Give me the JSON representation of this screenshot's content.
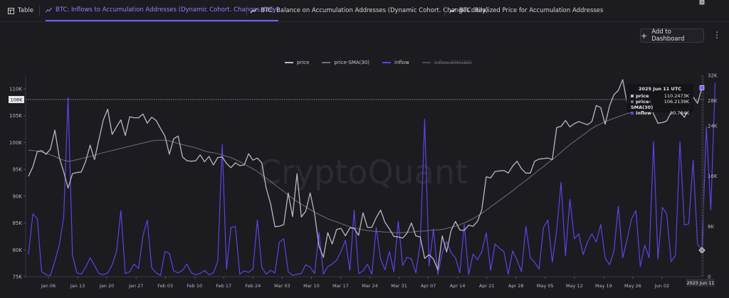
{
  "tabs": [
    {
      "label": "Table",
      "icon": "table-icon"
    },
    {
      "label": "BTC: Inflows to Accumulation Addresses (Dynamic Cohort. Changes daily)",
      "icon": "chart-icon",
      "active": true
    },
    {
      "label": "BTC: Balance on Accumulation Addresses (Dynamic Cohort. Changes daily)",
      "icon": "chart-icon"
    },
    {
      "label": "BTC: Realized Price for Accumulation Addresses",
      "icon": "chart-icon"
    }
  ],
  "toolbar": {
    "add_dashboard": "Add to Dashboard",
    "more": "⋮"
  },
  "watermark": "CryptoQuant",
  "colors": {
    "price": "#b8b8c0",
    "sma": "#6e6e76",
    "inflow": "#5b45e6",
    "inflow_sma": "#6a6a72"
  },
  "tooltip": {
    "date": "2025 Jun 11 UTC",
    "rows": [
      {
        "key": "price",
        "value": "110.2473K"
      },
      {
        "key": "price-SMA(30)",
        "value": "106.2139K"
      },
      {
        "key": "inflow",
        "value": "30.784K"
      }
    ]
  },
  "chart_data": {
    "type": "line",
    "legend": [
      {
        "name": "price",
        "color": "#b8b8c0",
        "hidden": false
      },
      {
        "name": "price-SMA(30)",
        "color": "#6e6e76",
        "hidden": false
      },
      {
        "name": "inflow",
        "color": "#5b45e6",
        "hidden": false
      },
      {
        "name": "inflow-SMA(30)",
        "color": "#6a6a72",
        "hidden": true
      }
    ],
    "left_axis": {
      "min": 75000,
      "max": 112500,
      "ticks": [
        75000,
        80000,
        85000,
        90000,
        95000,
        100000,
        105000,
        110000
      ],
      "tick_labels": [
        "75K",
        "80K",
        "85K",
        "90K",
        "95K",
        "100K",
        "105K",
        "110K"
      ]
    },
    "right_axis": {
      "min": 0,
      "max": 32000,
      "ticks": [
        0,
        8000,
        16000,
        24000,
        28000,
        32000
      ],
      "tick_labels": [
        "0",
        "8K",
        "16K",
        "24K",
        "28K",
        "32K"
      ]
    },
    "x_labels": [
      "Jan 06",
      "Jan 13",
      "Jan 20",
      "Jan 27",
      "Feb 03",
      "Feb 10",
      "Feb 17",
      "Feb 24",
      "Mar 03",
      "Mar 10",
      "Mar 17",
      "Mar 24",
      "Mar 31",
      "Apr 07",
      "Apr 14",
      "Apr 21",
      "Apr 28",
      "May 05",
      "May 12",
      "May 19",
      "May 26",
      "Jun 02"
    ],
    "hover_x_label": "2025 Jun 11",
    "ref_line": {
      "value": 108000,
      "label": "108K"
    },
    "series": [
      {
        "name": "price",
        "values": [
          93.7,
          95.5,
          98.3,
          98.5,
          97.8,
          98.8,
          102.3,
          97.2,
          94.5,
          91.5,
          94.2,
          94.4,
          94.5,
          96.5,
          99.5,
          96.8,
          100.5,
          104.2,
          106.2,
          101.5,
          102.9,
          104.2,
          101.3,
          104.8,
          104.6,
          104.6,
          105.3,
          103.6,
          104.7,
          104.1,
          102.6,
          101.2,
          97.8,
          100.7,
          101.2,
          97.3,
          96.6,
          96.5,
          96.6,
          97.7,
          96.4,
          97.4,
          95.8,
          97.2,
          97.3,
          96.1,
          95.3,
          96.2,
          95.7,
          95.8,
          97.9,
          96.7,
          97.1,
          96.2,
          91.5,
          88.6,
          84.3,
          84.4,
          84.7,
          90.6,
          86.2,
          94.2,
          86.1,
          87.2,
          90.6,
          86.7,
          80.7,
          78.6,
          83.2,
          81.1,
          83.8,
          84.0,
          82.6,
          84.1,
          84.0,
          82.7,
          86.9,
          84.2,
          84.2,
          86.0,
          87.4,
          85.1,
          83.9,
          82.5,
          82.4,
          82.2,
          83.1,
          85.0,
          82.6,
          82.4,
          78.4,
          79.1,
          78.3,
          76.3,
          82.6,
          79.6,
          83.6,
          85.3,
          83.7,
          83.6,
          84.6,
          84.4,
          85.3,
          87.5,
          93.6,
          93.4,
          94.6,
          94.7,
          94.8,
          94.3,
          95.6,
          96.5,
          95.1,
          94.3,
          94.3,
          96.5,
          96.9,
          97.0,
          97.1,
          96.8,
          102.8,
          103.0,
          104.1,
          102.9,
          103.5,
          103.9,
          103.6,
          103.3,
          103.9,
          106.9,
          106.5,
          103.4,
          106.8,
          108.9,
          109.7,
          111.7,
          107.3,
          109.0,
          108.9,
          107.8,
          109.0,
          108.8,
          105.3,
          103.6,
          103.7,
          104.0,
          105.6,
          105.8,
          105.7,
          104.7,
          106.3,
          108.5,
          107.3,
          110.2
        ]
      },
      {
        "name": "price-SMA(30)",
        "values": [
          98.6,
          98.5,
          98.4,
          98.2,
          98.0,
          97.7,
          97.4,
          97.0,
          96.7,
          96.5,
          96.6,
          96.8,
          97.0,
          97.2,
          97.4,
          97.6,
          97.9,
          98.1,
          98.3,
          98.5,
          98.7,
          98.9,
          99.1,
          99.3,
          99.5,
          99.7,
          99.9,
          100.1,
          100.3,
          100.4,
          100.4,
          100.4,
          100.3,
          100.1,
          99.8,
          99.6,
          99.4,
          99.2,
          99.0,
          98.7,
          98.4,
          98.2,
          98.1,
          97.9,
          97.7,
          97.4,
          97.2,
          96.8,
          96.4,
          96.0,
          95.5,
          95.1,
          94.6,
          94.0,
          93.4,
          92.8,
          92.1,
          91.5,
          90.9,
          90.2,
          89.6,
          89.0,
          88.5,
          88.0,
          87.5,
          87.0,
          86.6,
          86.2,
          85.8,
          85.5,
          85.2,
          84.9,
          84.6,
          84.3,
          84.1,
          83.9,
          83.7,
          83.6,
          83.5,
          83.4,
          83.4,
          83.3,
          83.3,
          83.2,
          83.2,
          83.2,
          83.3,
          83.3,
          83.4,
          83.5,
          83.5,
          83.6,
          83.7,
          83.7,
          83.8,
          84.0,
          84.2,
          84.4,
          84.7,
          85.0,
          85.4,
          85.8,
          86.3,
          86.8,
          87.4,
          88.0,
          88.6,
          89.2,
          89.8,
          90.4,
          91.0,
          91.7,
          92.3,
          92.9,
          93.6,
          94.2,
          94.9,
          95.5,
          96.2,
          96.8,
          97.5,
          98.2,
          98.9,
          99.6,
          100.2,
          100.8,
          101.4,
          102.0,
          102.6,
          103.1,
          103.5,
          103.9,
          104.2,
          104.5,
          104.8,
          105.1,
          105.4,
          105.6,
          105.8,
          105.9,
          106.0,
          106.05,
          106.1,
          106.12,
          106.15,
          106.17,
          106.19,
          106.2,
          106.21,
          106.21,
          106.21,
          106.2139
        ]
      },
      {
        "name": "inflow",
        "values": [
          3.5,
          10.0,
          9.2,
          0.8,
          0.3,
          0.2,
          2.5,
          5.0,
          9.5,
          28.5,
          3.4,
          0.6,
          0.4,
          1.5,
          3.0,
          1.8,
          0.5,
          0.3,
          0.6,
          1.9,
          4.0,
          10.5,
          0.5,
          0.8,
          2.0,
          1.3,
          6.5,
          9.0,
          1.4,
          0.6,
          0.2,
          4.0,
          3.7,
          0.9,
          0.6,
          1.0,
          2.0,
          0.6,
          0.3,
          0.5,
          1.0,
          0.3,
          0.6,
          2.4,
          21.0,
          1.2,
          7.8,
          8.0,
          0.4,
          0.9,
          0.7,
          1.2,
          9.0,
          1.5,
          0.4,
          1.0,
          0.6,
          5.5,
          6.0,
          0.8,
          0.2,
          0.4,
          0.5,
          1.9,
          1.5,
          0.5,
          7.0,
          0.4,
          1.6,
          2.0,
          2.6,
          4.0,
          5.8,
          1.0,
          10.6,
          0.5,
          0.9,
          2.0,
          0.4,
          7.8,
          2.8,
          1.1,
          4.0,
          0.8,
          8.8,
          1.8,
          3.1,
          2.8,
          0.6,
          5.3,
          25.0,
          1.7,
          7.6,
          0.3,
          3.8,
          5.6,
          3.8,
          3.0,
          0.6,
          8.3,
          0.3,
          3.6,
          2.7,
          4.0,
          7.0,
          1.0,
          5.2,
          4.5,
          4.0,
          0.4,
          4.1,
          2.6,
          0.8,
          8.0,
          3.0,
          2.3,
          1.2,
          7.8,
          9.0,
          2.3,
          7.4,
          15.0,
          3.3,
          12.3,
          6.0,
          6.8,
          3.5,
          5.5,
          6.8,
          5.5,
          8.3,
          3.0,
          1.9,
          4.0,
          11.2,
          3.0,
          5.9,
          9.2,
          10.5,
          1.6,
          5.0,
          3.0,
          21.5,
          2.8,
          11.0,
          10.0,
          2.4,
          3.4,
          21.5,
          8.2,
          8.4,
          18.5,
          5.2,
          4.2,
          23.8,
          10.6,
          30.784
        ]
      }
    ]
  }
}
